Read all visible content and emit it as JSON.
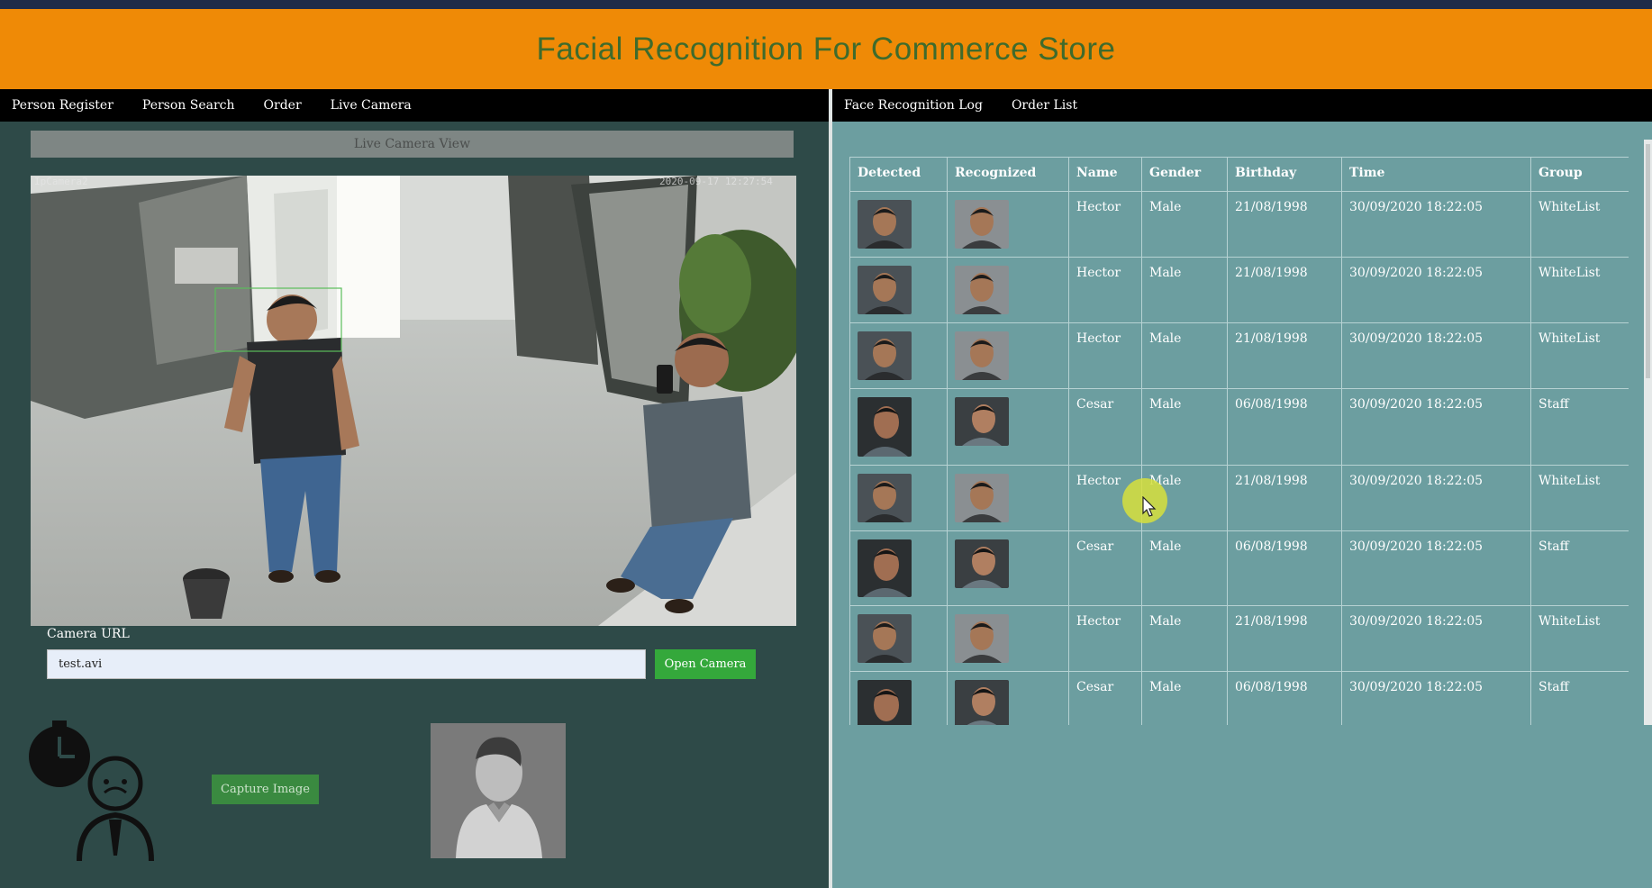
{
  "header": {
    "title": "Facial Recognition For Commerce Store"
  },
  "nav_left": [
    "Person Register",
    "Person Search",
    "Order",
    "Live Camera"
  ],
  "nav_right": [
    "Face Recognition Log",
    "Order List"
  ],
  "camera": {
    "panel_title": "Live Camera View",
    "url_label": "Camera URL",
    "url_value": "test.avi",
    "open_button": "Open Camera",
    "capture_button": "Capture Image"
  },
  "log": {
    "columns": [
      "Detected",
      "Recognized",
      "Name",
      "Gender",
      "Birthday",
      "Time",
      "Group"
    ],
    "rows": [
      {
        "name": "Hector",
        "gender": "Male",
        "birthday": "21/08/1998",
        "time": "30/09/2020 18:22:05",
        "group": "WhiteList"
      },
      {
        "name": "Hector",
        "gender": "Male",
        "birthday": "21/08/1998",
        "time": "30/09/2020 18:22:05",
        "group": "WhiteList"
      },
      {
        "name": "Hector",
        "gender": "Male",
        "birthday": "21/08/1998",
        "time": "30/09/2020 18:22:05",
        "group": "WhiteList"
      },
      {
        "name": "Cesar",
        "gender": "Male",
        "birthday": "06/08/1998",
        "time": "30/09/2020 18:22:05",
        "group": "Staff"
      },
      {
        "name": "Hector",
        "gender": "Male",
        "birthday": "21/08/1998",
        "time": "30/09/2020 18:22:05",
        "group": "WhiteList"
      },
      {
        "name": "Cesar",
        "gender": "Male",
        "birthday": "06/08/1998",
        "time": "30/09/2020 18:22:05",
        "group": "Staff"
      },
      {
        "name": "Hector",
        "gender": "Male",
        "birthday": "21/08/1998",
        "time": "30/09/2020 18:22:05",
        "group": "WhiteList"
      },
      {
        "name": "Cesar",
        "gender": "Male",
        "birthday": "06/08/1998",
        "time": "30/09/2020 18:22:05",
        "group": "Staff"
      }
    ]
  },
  "colors": {
    "header_bg": "#ef8a06",
    "title": "#3f6b2c",
    "left_bg": "#2e4a48",
    "right_bg": "#6c9ea0",
    "button_green": "#34a83b"
  },
  "icons": [
    "timer-person-icon",
    "person-silhouette-icon",
    "mouse-cursor-icon"
  ]
}
